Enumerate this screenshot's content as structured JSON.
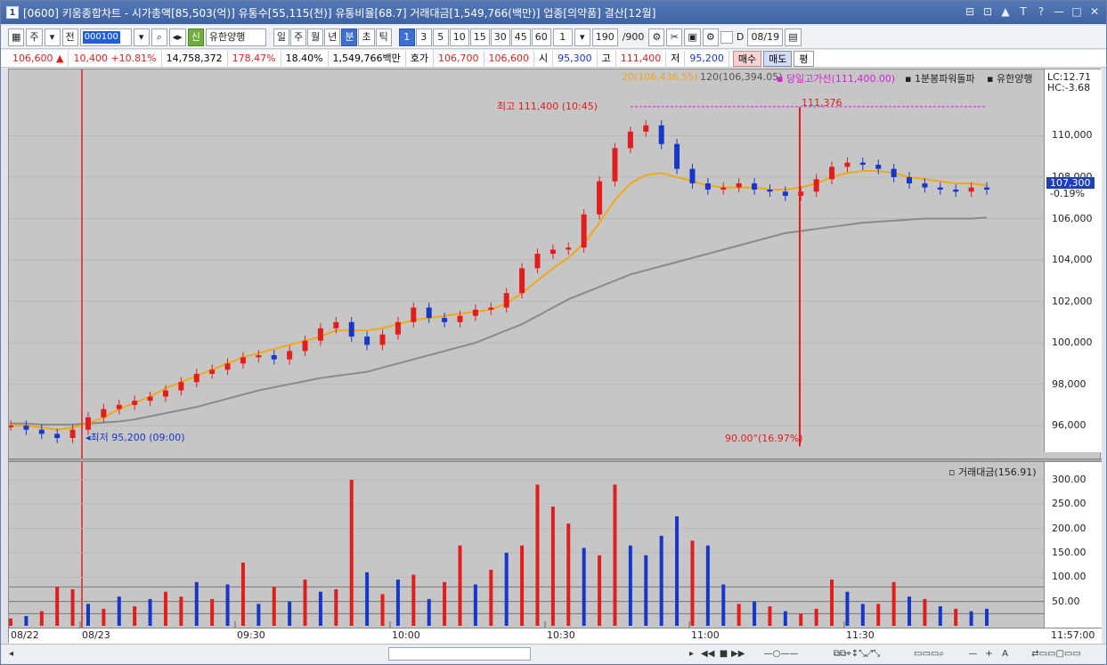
{
  "title": "[0600] 키움종합차트 - 시가총액[85,503(억)] 유통수[55,115(천)] 유통비율[68.7] 거래대금[1,549,766(백만)] 업종[의약품] 결산[12월]",
  "app_number": "1",
  "window_buttons": [
    "⊟",
    "⊡",
    "▲",
    "T",
    "?",
    "—",
    "□",
    "✕"
  ],
  "toolbar": {
    "period_type": "주",
    "prev": "전",
    "code": "000100",
    "stock_badge": "신",
    "stock_name": "유한양행",
    "periods": [
      "일",
      "주",
      "월",
      "년",
      "분",
      "초",
      "틱"
    ],
    "active_period": "분",
    "intervals": [
      "1",
      "3",
      "5",
      "10",
      "15",
      "30",
      "45",
      "60"
    ],
    "active_interval": "1",
    "interval_select": "1",
    "count": "190",
    "count_max": "/900",
    "date": "08/19",
    "d_label": "D"
  },
  "infobar": {
    "price": "106,600",
    "change": "10,400",
    "change_pct": "+10.81%",
    "volume": "14,758,372",
    "vol_ratio": "178.47%",
    "turnover": "18.40%",
    "amount": "1,549,766백만",
    "quote_label": "호가",
    "bid": "106,700",
    "ask": "106,600",
    "open_label": "시",
    "open": "95,300",
    "high_label": "고",
    "high": "111,400",
    "low_label": "저",
    "low": "95,200",
    "buy": "매수",
    "sell": "매도",
    "eval": "평"
  },
  "legend": {
    "ma20": "20(106,436.55)",
    "ma120": "120(106,394.05)",
    "day_high_line": "당일고가선(111,400.00)",
    "indicator": "1분봉파워돌파",
    "stock": "유한양행",
    "lc": "LC:12.71",
    "hc": "HC:-3.68"
  },
  "annotations": {
    "high_mark": "최고 111,400 (10:45)",
    "low_mark": "최저 95,200 (09:00)",
    "vline_top": "111,376",
    "vline_bottom": "90.00°(16.97%)"
  },
  "price_axis": [
    "110,000",
    "108,000",
    "106,000",
    "104,000",
    "102,000",
    "100,000",
    "98,000",
    "96,000"
  ],
  "current_price_tag": "107,300",
  "current_change_tag": "-0.19%",
  "volume_legend": "거래대금(156.91)",
  "volume_axis": [
    "300.00",
    "250.00",
    "200.00",
    "150.00",
    "100.00",
    "50.00"
  ],
  "time_axis": [
    "08/22",
    "08/23",
    "09:30",
    "10:00",
    "10:30",
    "11:00",
    "11:30",
    "11:57:00"
  ],
  "colors": {
    "up": "#e31c1c",
    "down": "#1836c9",
    "ma20": "#f0a818",
    "ma120": "#8a8a8a",
    "dayhigh": "#d81ed8",
    "chart_bg": "#c6c6c6"
  },
  "chart_data": {
    "type": "line",
    "title": "",
    "xlabel": "",
    "ylabel": "",
    "ylim": [
      94800,
      112600
    ],
    "price_series_close": [
      96000,
      95800,
      95600,
      95400,
      95800,
      96400,
      96800,
      97000,
      97200,
      97400,
      97700,
      98100,
      98500,
      98700,
      99000,
      99300,
      99400,
      99200,
      99600,
      100100,
      100700,
      101000,
      100300,
      99900,
      100400,
      101000,
      101700,
      101200,
      101000,
      101300,
      101600,
      101700,
      102400,
      103600,
      104300,
      104500,
      104600,
      106200,
      107800,
      109400,
      110200,
      110500,
      109600,
      108400,
      107700,
      107400,
      107500,
      107700,
      107400,
      107300,
      107100,
      107300,
      107900,
      108500,
      108700,
      108600,
      108400,
      108000,
      107700,
      107500,
      107400,
      107300,
      107500,
      107400
    ],
    "ma20": [
      96000,
      96000,
      95900,
      95800,
      95900,
      96100,
      96400,
      96800,
      97100,
      97400,
      97800,
      98100,
      98400,
      98700,
      99000,
      99300,
      99500,
      99700,
      99900,
      100100,
      100300,
      100600,
      100600,
      100600,
      100700,
      100900,
      101100,
      101200,
      101300,
      101400,
      101500,
      101600,
      101900,
      102400,
      103000,
      103600,
      104100,
      104800,
      105800,
      106900,
      107700,
      108100,
      108200,
      108000,
      107800,
      107600,
      107500,
      107500,
      107500,
      107400,
      107400,
      107500,
      107700,
      108000,
      108200,
      108300,
      108300,
      108200,
      108000,
      107900,
      107800,
      107700,
      107700,
      107600
    ],
    "ma120": [
      96100,
      96100,
      96050,
      96050,
      96050,
      96100,
      96150,
      96200,
      96300,
      96450,
      96600,
      96750,
      96900,
      97100,
      97300,
      97500,
      97700,
      97850,
      98000,
      98150,
      98300,
      98400,
      98500,
      98600,
      98800,
      99000,
      99200,
      99400,
      99600,
      99800,
      100000,
      100300,
      100600,
      100900,
      101300,
      101700,
      102100,
      102400,
      102700,
      103000,
      103300,
      103500,
      103700,
      103900,
      104100,
      104300,
      104500,
      104700,
      104900,
      105100,
      105300,
      105400,
      105500,
      105600,
      105700,
      105800,
      105850,
      105900,
      105950,
      106000,
      106000,
      106000,
      106000,
      106050
    ],
    "day_high": 111400,
    "volume_ylim": [
      0,
      320
    ],
    "volume_values": [
      15,
      20,
      30,
      80,
      75,
      45,
      35,
      60,
      40,
      55,
      70,
      60,
      90,
      55,
      85,
      130,
      45,
      80,
      50,
      95,
      70,
      75,
      300,
      110,
      65,
      95,
      105,
      55,
      90,
      165,
      85,
      115,
      150,
      165,
      290,
      245,
      210,
      160,
      145,
      290,
      165,
      145,
      185,
      225,
      175,
      165,
      85,
      45,
      50,
      40,
      30,
      25,
      35,
      95,
      70,
      45,
      45,
      90,
      60,
      55,
      40,
      35,
      30,
      35
    ],
    "volume_up": [
      true,
      false,
      true,
      true,
      true,
      false,
      true,
      false,
      true,
      false,
      true,
      true,
      false,
      true,
      false,
      true,
      false,
      true,
      false,
      true,
      false,
      true,
      true,
      false,
      true,
      false,
      true,
      false,
      true,
      true,
      false,
      true,
      false,
      true,
      true,
      true,
      true,
      false,
      true,
      true,
      false,
      false,
      false,
      false,
      true,
      false,
      false,
      true,
      false,
      true,
      false,
      true,
      true,
      true,
      false,
      false,
      true,
      true,
      false,
      true,
      false,
      true,
      false,
      false
    ]
  }
}
